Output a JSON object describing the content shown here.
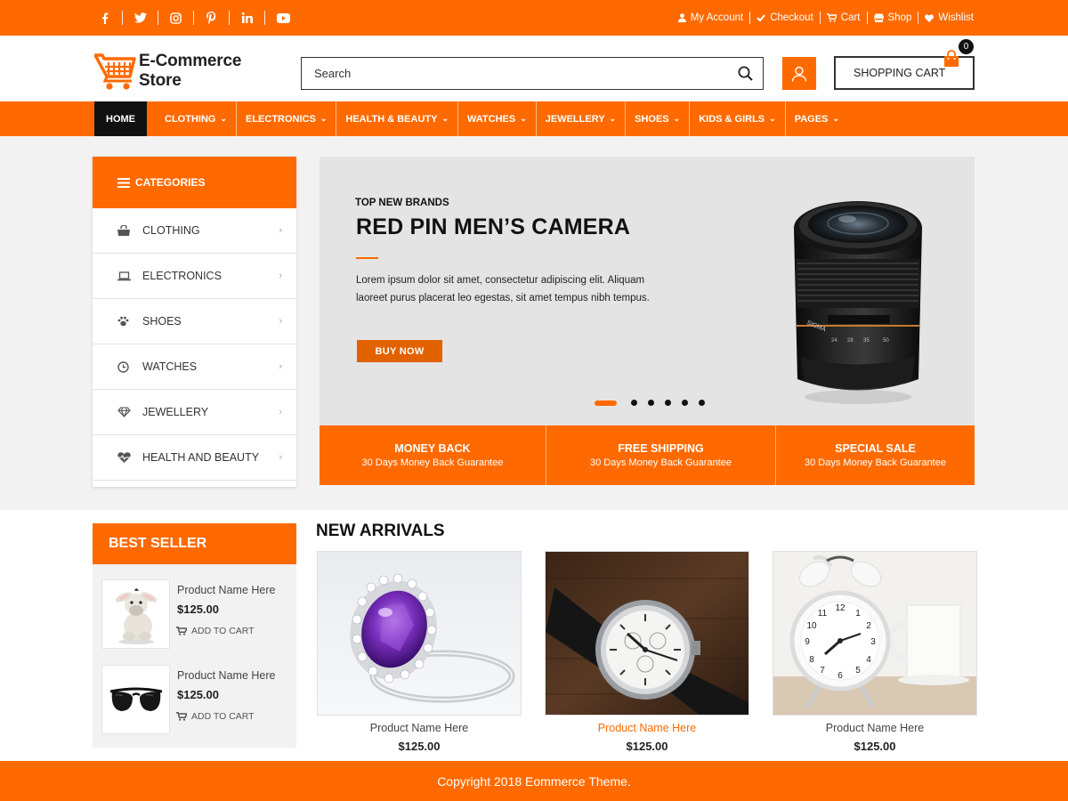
{
  "colors": {
    "accent": "#ff6a00",
    "dark": "#111111",
    "panel": "#f2f2f2"
  },
  "topbar": {
    "social": [
      "facebook-icon",
      "twitter-icon",
      "instagram-icon",
      "pinterest-icon",
      "linkedin-icon",
      "youtube-icon"
    ],
    "links": [
      {
        "label": "My Account",
        "icon": "user-icon"
      },
      {
        "label": "Checkout",
        "icon": "check-icon"
      },
      {
        "label": "Cart",
        "icon": "cart-icon"
      },
      {
        "label": "Shop",
        "icon": "shop-icon"
      },
      {
        "label": "Wishlist",
        "icon": "heart-icon"
      }
    ]
  },
  "header": {
    "logo_line1": "E-Commerce",
    "logo_line2": "Store",
    "search_placeholder": "Search",
    "cart_label": "SHOPPING CART",
    "cart_count": "0"
  },
  "nav": {
    "items": [
      {
        "label": "HOME"
      },
      {
        "label": "CLOTHING"
      },
      {
        "label": "ELECTRONICS"
      },
      {
        "label": "HEALTH & BEAUTY"
      },
      {
        "label": "WATCHES"
      },
      {
        "label": "JEWELLERY"
      },
      {
        "label": "SHOES"
      },
      {
        "label": "KIDS & GIRLS"
      },
      {
        "label": "PAGES"
      }
    ]
  },
  "categories": {
    "title": "CATEGORIES",
    "items": [
      {
        "label": "CLOTHING",
        "icon": "shopping-bag-icon"
      },
      {
        "label": "ELECTRONICS",
        "icon": "laptop-icon"
      },
      {
        "label": "SHOES",
        "icon": "paw-icon"
      },
      {
        "label": "WATCHES",
        "icon": "clock-icon"
      },
      {
        "label": "JEWELLERY",
        "icon": "diamond-icon"
      },
      {
        "label": "HEALTH AND BEAUTY",
        "icon": "heartbeat-icon"
      }
    ]
  },
  "slider": {
    "subtitle": "TOP NEW BRANDS",
    "title": "RED PIN MEN’S CAMERA",
    "description": "Lorem ipsum dolor sit amet, consectetur adipiscing elit. Aliquam laoreet purus placerat leo egestas, sit amet tempus nibh tempus.",
    "button": "BUY  NOW",
    "lens_brand": "SIGMA",
    "slide_count": 6,
    "active_slide": 1
  },
  "features": [
    {
      "title": "MONEY BACK",
      "subtitle": "30 Days Money Back Guarantee"
    },
    {
      "title": "FREE SHIPPING",
      "subtitle": "30 Days Money Back Guarantee"
    },
    {
      "title": "SPECIAL SALE",
      "subtitle": "30 Days Money Back Guarantee"
    }
  ],
  "best_seller": {
    "title": "BEST SELLER",
    "items": [
      {
        "name": "Product Name Here",
        "price": "$125.00",
        "cta": "ADD TO CART",
        "image": "plush-donkey"
      },
      {
        "name": "Product Name Here",
        "price": "$125.00",
        "cta": "ADD TO CART",
        "image": "sunglasses"
      }
    ]
  },
  "new_arrivals": {
    "title": "NEW ARRIVALS",
    "products": [
      {
        "name": "Product Name Here",
        "price": "$125.00",
        "image": "amethyst-ring"
      },
      {
        "name": "Product Name Here",
        "price": "$125.00",
        "image": "wristwatch"
      },
      {
        "name": "Product Name Here",
        "price": "$125.00",
        "image": "alarm-clock"
      }
    ]
  },
  "footer": {
    "text": "Copyright 2018 Eommerce Theme."
  }
}
